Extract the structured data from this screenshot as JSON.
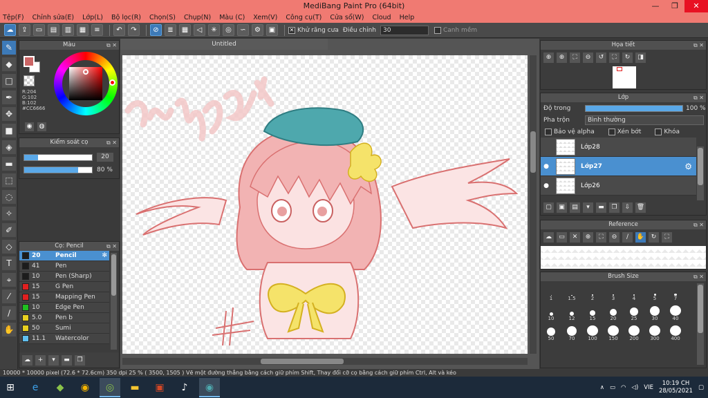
{
  "window": {
    "title": "MediBang Paint Pro (64bit)",
    "min": "—",
    "max": "❐",
    "close": "✕"
  },
  "menu": [
    "Tệp(F)",
    "Chỉnh sửa(E)",
    "Lớp(L)",
    "Bộ lọc(R)",
    "Chọn(S)",
    "Chụp(N)",
    "Màu (C)",
    "Xem(V)",
    "Công cụ(T)",
    "Cửa sổ(W)",
    "Cloud",
    "Help"
  ],
  "toolbar": {
    "antialias_label": "Khử răng cưa",
    "antialias_checked": "✕",
    "adjust_label": "Điều chỉnh",
    "adjust_value": "30",
    "smooth_label": "Canh mềm"
  },
  "color_panel": {
    "title": "Màu",
    "r": "R:204",
    "g": "G:102",
    "b": "B:102",
    "hex": "#CC6666",
    "fg": "#CC6666"
  },
  "brush_control": {
    "title": "Kiểm soát cọ",
    "size": "20",
    "opacity": "80 %",
    "size_fraction": 0.2,
    "opacity_fraction": 0.8
  },
  "brush_panel": {
    "title": "Cọ: Pencil",
    "brushes": [
      {
        "size": "20",
        "name": "Pencil",
        "color": "#1c1c1c"
      },
      {
        "size": "41",
        "name": "Pen",
        "color": "#1c1c1c"
      },
      {
        "size": "10",
        "name": "Pen (Sharp)",
        "color": "#1c1c1c"
      },
      {
        "size": "15",
        "name": "G Pen",
        "color": "#e02020"
      },
      {
        "size": "15",
        "name": "Mapping Pen",
        "color": "#e02020"
      },
      {
        "size": "10",
        "name": "Edge Pen",
        "color": "#20c020"
      },
      {
        "size": "5.0",
        "name": "Pen b",
        "color": "#e8d020"
      },
      {
        "size": "50",
        "name": "Sumi",
        "color": "#e8d020"
      },
      {
        "size": "11.1",
        "name": "Watercolor",
        "color": "#60c0f0"
      }
    ]
  },
  "canvas": {
    "tab_title": "Untitled"
  },
  "navigator": {
    "title": "Họa tiết"
  },
  "layer_panel": {
    "title": "Lớp",
    "opacity_label": "Độ trong",
    "opacity_value": "100 %",
    "blend_label": "Pha trộn",
    "blend_value": "Bình thường",
    "protect_alpha": "Bảo vệ alpha",
    "clipping": "Xén bớt",
    "lock": "Khóa",
    "layers": [
      {
        "name": "Lớp28"
      },
      {
        "name": "Lớp27"
      },
      {
        "name": "Lớp26"
      }
    ]
  },
  "reference": {
    "title": "Reference"
  },
  "brush_size": {
    "title": "Brush Size",
    "sizes": [
      "1",
      "1.5",
      "2",
      "3",
      "4",
      "5",
      "7",
      "10",
      "12",
      "15",
      "20",
      "25",
      "30",
      "40",
      "50",
      "70",
      "100",
      "150",
      "200",
      "300",
      "400"
    ]
  },
  "status": "10000 * 10000 pixel   (72.6 * 72.6cm)   350 dpi   25 %   ( 3500, 1505 )   Vẽ một đường thẳng bằng cách giữ phím Shift, Thay đổi cỡ cọ bằng cách giữ phím Ctrl, Alt và kéo",
  "tray": {
    "lang": "VIE",
    "time": "10:19 CH",
    "date": "28/05/2021"
  }
}
